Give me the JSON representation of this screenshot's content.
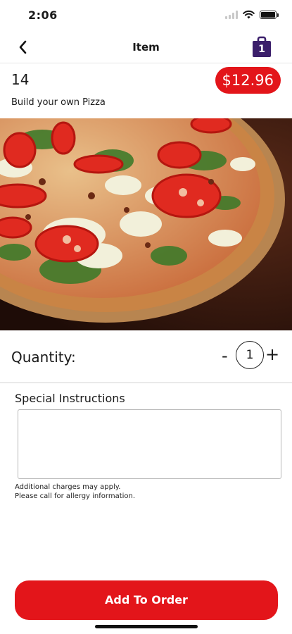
{
  "status_bar": {
    "time": "2:06",
    "battery_level": 1.0
  },
  "nav": {
    "title": "Item",
    "bag_count": "1",
    "bag_color": "#3b1f6b"
  },
  "item": {
    "number": "14",
    "name": "Build your own Pizza",
    "price": "$12.96"
  },
  "colors": {
    "accent_red": "#e3151a",
    "bag_purple": "#3b1f6b"
  },
  "quantity": {
    "label": "Quantity:",
    "minus": "-",
    "value": "1",
    "plus": "+"
  },
  "special_instructions": {
    "label": "Special Instructions",
    "value": "",
    "note_line1": "Additional charges may apply.",
    "note_line2": "Please call for allergy information."
  },
  "actions": {
    "add_to_order": "Add To Order"
  },
  "icons": {
    "back": "chevron-left-icon",
    "bag": "shopping-bag-icon",
    "wifi": "wifi-icon",
    "signal": "signal-icon",
    "battery": "battery-icon"
  }
}
